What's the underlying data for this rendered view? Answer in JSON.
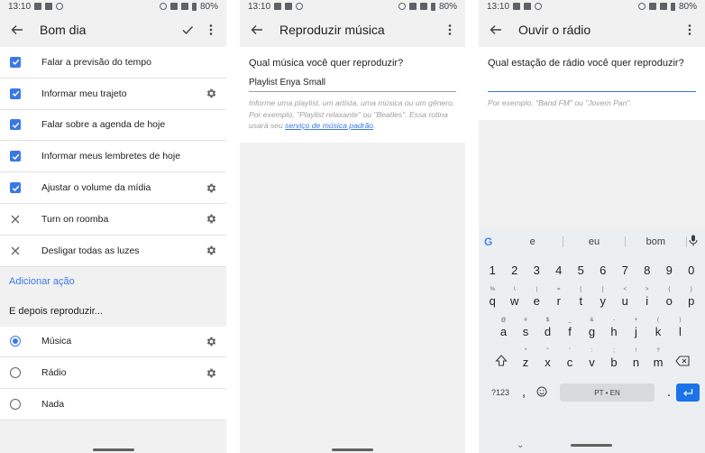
{
  "status": {
    "time": "13:10",
    "battery": "80%"
  },
  "screen1": {
    "title": "Bom dia",
    "items": [
      {
        "label": "Falar a previsão do tempo",
        "state": "checked",
        "settings": false
      },
      {
        "label": "Informar meu trajeto",
        "state": "checked",
        "settings": true
      },
      {
        "label": "Falar sobre a agenda de hoje",
        "state": "checked",
        "settings": false
      },
      {
        "label": "Informar meus lembretes de hoje",
        "state": "checked",
        "settings": false
      },
      {
        "label": "Ajustar o volume da mídia",
        "state": "checked",
        "settings": true
      },
      {
        "label": "Turn on roomba",
        "state": "removed",
        "settings": true
      },
      {
        "label": "Desligar todas as luzes",
        "state": "removed",
        "settings": true
      }
    ],
    "add_action": "Adicionar ação",
    "then_heading": "E depois reproduzir...",
    "options": [
      {
        "label": "Música",
        "selected": true,
        "settings": true
      },
      {
        "label": "Rádio",
        "selected": false,
        "settings": true
      },
      {
        "label": "Nada",
        "selected": false,
        "settings": false
      }
    ]
  },
  "screen2": {
    "title": "Reproduzir música",
    "question": "Qual música você quer reproduzir?",
    "input_value": "Playlist Enya Small",
    "hint": "Informe uma playlist, um artista, uma música ou um gênero. Por exemplo, \"Playlist relaxante\" ou \"Beatles\". Essa rotina usará seu ",
    "hint_link": "serviço de música padrão",
    "hint_end": "."
  },
  "screen3": {
    "title": "Ouvir o rádio",
    "question": "Qual estação de rádio você quer reproduzir?",
    "input_value": "",
    "hint": "Por exemplo, \"Band FM\" ou \"Jovem Pan\".",
    "keyboard": {
      "suggestions": [
        "e",
        "eu",
        "bom"
      ],
      "row1": [
        "1",
        "2",
        "3",
        "4",
        "5",
        "6",
        "7",
        "8",
        "9",
        "0"
      ],
      "row2": [
        {
          "k": "q",
          "s": "%"
        },
        {
          "k": "w",
          "s": "\\"
        },
        {
          "k": "e",
          "s": "|"
        },
        {
          "k": "r",
          "s": "="
        },
        {
          "k": "t",
          "s": "["
        },
        {
          "k": "y",
          "s": "]"
        },
        {
          "k": "u",
          "s": "<"
        },
        {
          "k": "i",
          "s": ">"
        },
        {
          "k": "o",
          "s": "{"
        },
        {
          "k": "p",
          "s": "}"
        }
      ],
      "row3": [
        {
          "k": "a",
          "s": "@"
        },
        {
          "k": "s",
          "s": "#"
        },
        {
          "k": "d",
          "s": "$"
        },
        {
          "k": "f",
          "s": "_"
        },
        {
          "k": "g",
          "s": "&"
        },
        {
          "k": "h",
          "s": "-"
        },
        {
          "k": "j",
          "s": "+"
        },
        {
          "k": "k",
          "s": "("
        },
        {
          "k": "l",
          "s": ")"
        }
      ],
      "row4": [
        {
          "k": "z",
          "s": "*"
        },
        {
          "k": "x",
          "s": "\""
        },
        {
          "k": "c",
          "s": "'"
        },
        {
          "k": "v",
          "s": ":"
        },
        {
          "k": "b",
          "s": ";"
        },
        {
          "k": "n",
          "s": "!"
        },
        {
          "k": "m",
          "s": "?"
        }
      ],
      "num_label": "?123",
      "comma": ",",
      "space_label": "PT • EN",
      "period": "."
    }
  }
}
